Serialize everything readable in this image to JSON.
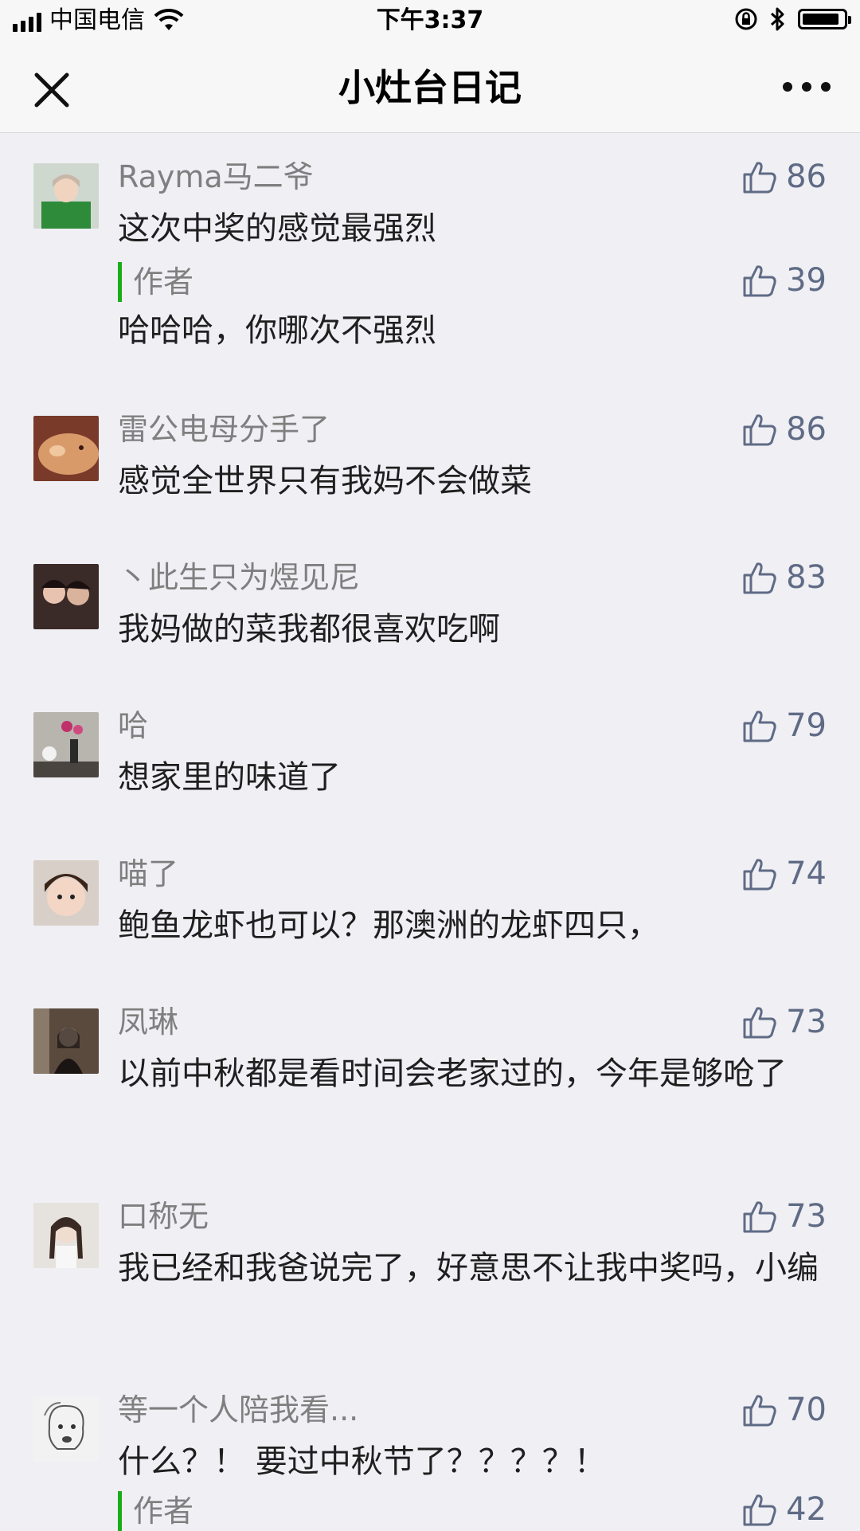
{
  "status_bar": {
    "carrier": "中国电信",
    "time": "下午3:37"
  },
  "nav": {
    "title": "小灶台日记"
  },
  "comments": [
    {
      "nickname": "Rayma马二爷",
      "text": "这次中奖的感觉最强烈",
      "likes": "86",
      "reply": {
        "label": "作者",
        "text": "哈哈哈，你哪次不强烈",
        "likes": "39"
      }
    },
    {
      "nickname": "雷公电母分手了",
      "text": "感觉全世界只有我妈不会做菜",
      "likes": "86"
    },
    {
      "nickname": "丶此生只为煜见尼",
      "text": "我妈做的菜我都很喜欢吃啊",
      "likes": "83"
    },
    {
      "nickname": "哈",
      "text": "想家里的味道了",
      "likes": "79"
    },
    {
      "nickname": "喵了",
      "text": "鲍鱼龙虾也可以？那澳洲的龙虾四只，",
      "likes": "74"
    },
    {
      "nickname": "凤琳",
      "text": "以前中秋都是看时间会老家过的，今年是够呛了",
      "likes": "73"
    },
    {
      "nickname": "口称无",
      "text": "我已经和我爸说完了，好意思不让我中奖吗，小编",
      "likes": "73"
    },
    {
      "nickname": "等一个人陪我看...",
      "text": "什么？！ 要过中秋节了？？？？！",
      "likes": "70",
      "reply": {
        "label": "作者",
        "likes": "42"
      }
    }
  ]
}
